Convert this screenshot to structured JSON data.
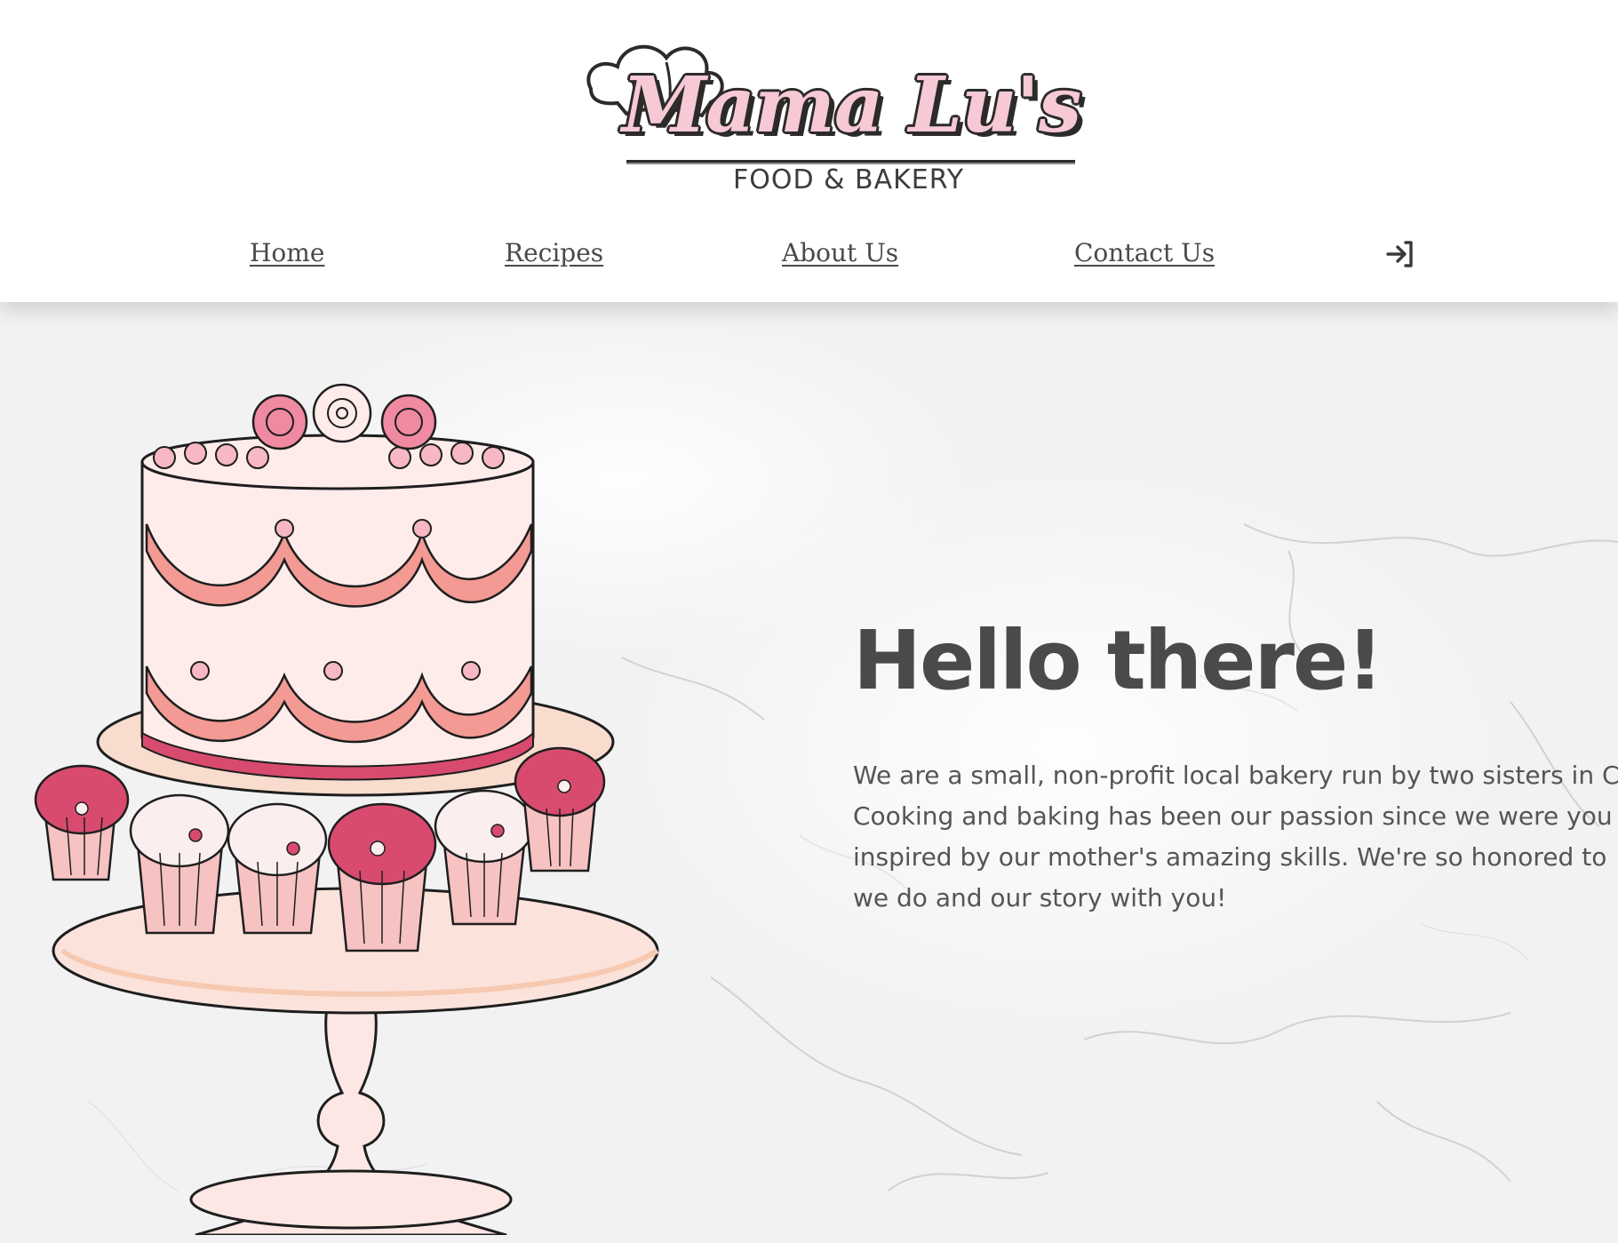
{
  "logo": {
    "script_text": "Mama Lu's",
    "subtitle": "FOOD & BAKERY",
    "icon": "chef-hat-icon"
  },
  "nav": {
    "items": [
      {
        "label": "Home"
      },
      {
        "label": "Recipes"
      },
      {
        "label": "About Us"
      },
      {
        "label": "Contact Us"
      }
    ],
    "login_icon": "sign-in-icon"
  },
  "hero": {
    "title": "Hello there!",
    "lines": [
      "We are a small, non-profit local bakery run by two sisters in C",
      "Cooking and baking has been our passion since we were you",
      "inspired by our mother's amazing skills. We're so honored to",
      "we do and our story with you!"
    ],
    "illustration": "tiered-cake-with-cupcakes-illustration"
  },
  "colors": {
    "background": "#ffffff",
    "marble": "#f3f2f3",
    "text_dark": "#4a4a4a",
    "pink_light": "#f7c9d4",
    "salmon": "#f09a96",
    "raspberry": "#d84b6e"
  }
}
